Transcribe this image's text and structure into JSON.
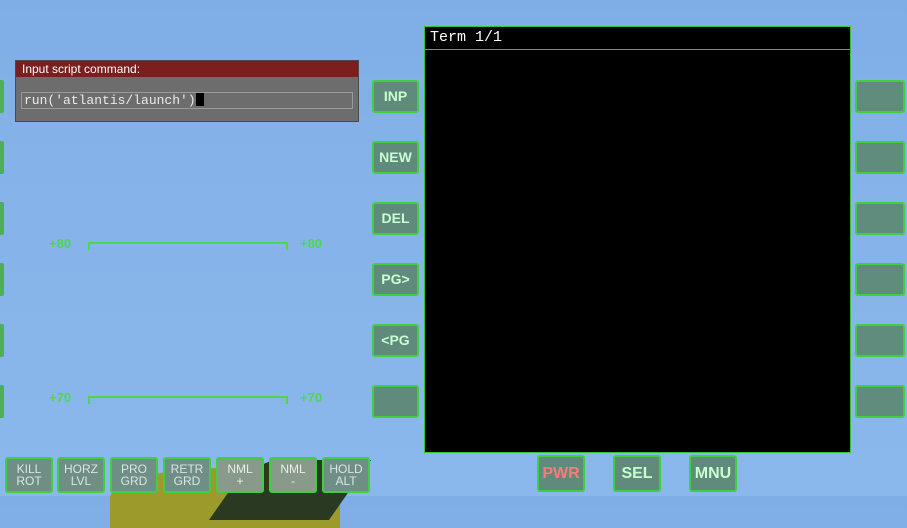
{
  "dialog": {
    "title": "Input script command:",
    "value": "run('atlantis/launch')"
  },
  "terminal": {
    "title": "Term 1/1"
  },
  "left_buttons": [
    "INP",
    "NEW",
    "DEL",
    "PG>",
    "<PG",
    ""
  ],
  "hud": {
    "upper_label_left": "+80",
    "upper_label_right": "+80",
    "lower_label_left": "+70",
    "lower_label_right": "+70"
  },
  "bottom_buttons": [
    "KILL\nROT",
    "HORZ\nLVL",
    "PRO\nGRD",
    "RETR\nGRD",
    "NML\n+",
    "NML\n-",
    "HOLD\nALT"
  ],
  "controls": {
    "pwr": "PWR",
    "sel": "SEL",
    "mnu": "MNU",
    "pwr_color": "#ff7a7a",
    "accent_green": "#3fcf3f"
  }
}
